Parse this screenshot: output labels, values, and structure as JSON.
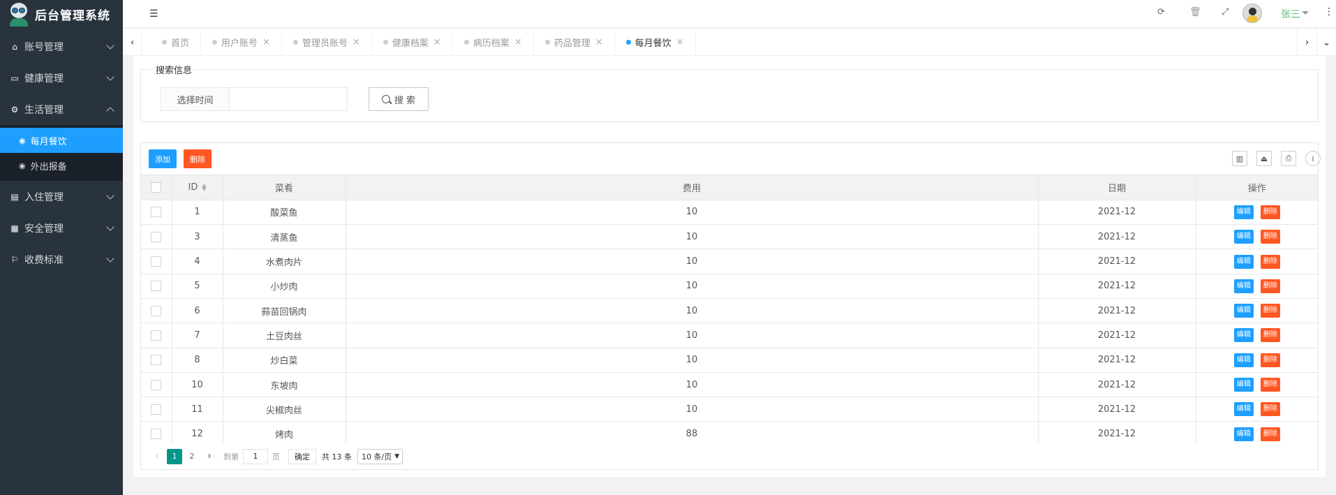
{
  "app": {
    "title": "后台管理系统"
  },
  "sidebar": {
    "items": [
      {
        "label": "账号管理",
        "icon": "home-icon",
        "expanded": false
      },
      {
        "label": "健康管理",
        "icon": "window-icon",
        "expanded": false
      },
      {
        "label": "生活管理",
        "icon": "gears-icon",
        "expanded": true
      },
      {
        "label": "入住管理",
        "icon": "file-icon",
        "expanded": false
      },
      {
        "label": "安全管理",
        "icon": "calendar-icon",
        "expanded": false
      },
      {
        "label": "收费标准",
        "icon": "flag-icon",
        "expanded": false
      }
    ],
    "subitems": [
      {
        "label": "每月餐饮",
        "icon": "dashboard-icon",
        "active": true
      },
      {
        "label": "外出报备",
        "icon": "dashboard-icon",
        "active": false
      }
    ]
  },
  "header": {
    "username": "张三",
    "icons": [
      "refresh-icon",
      "trash-icon",
      "fullscreen-icon",
      "more-icon"
    ]
  },
  "tabs": [
    {
      "label": "首页",
      "closable": false,
      "active": false
    },
    {
      "label": "用户账号",
      "closable": true,
      "active": false
    },
    {
      "label": "管理员账号",
      "closable": true,
      "active": false
    },
    {
      "label": "健康档案",
      "closable": true,
      "active": false
    },
    {
      "label": "病历档案",
      "closable": true,
      "active": false
    },
    {
      "label": "药品管理",
      "closable": true,
      "active": false
    },
    {
      "label": "每月餐饮",
      "closable": true,
      "active": true
    }
  ],
  "search": {
    "legend": "搜索信息",
    "label": "选择时间",
    "value": "",
    "button": "搜 索"
  },
  "toolbar": {
    "add_label": "添加",
    "delete_label": "删除"
  },
  "table": {
    "columns": [
      "ID",
      "菜肴",
      "费用",
      "日期",
      "操作"
    ],
    "edit_label": "编辑",
    "delete_label": "删除",
    "rows": [
      {
        "id": "1",
        "dish": "酸菜鱼",
        "cost": "10",
        "date": "2021-12"
      },
      {
        "id": "3",
        "dish": "清蒸鱼",
        "cost": "10",
        "date": "2021-12"
      },
      {
        "id": "4",
        "dish": "水煮肉片",
        "cost": "10",
        "date": "2021-12"
      },
      {
        "id": "5",
        "dish": "小炒肉",
        "cost": "10",
        "date": "2021-12"
      },
      {
        "id": "6",
        "dish": "蒜苗回锅肉",
        "cost": "10",
        "date": "2021-12"
      },
      {
        "id": "7",
        "dish": "土豆肉丝",
        "cost": "10",
        "date": "2021-12"
      },
      {
        "id": "8",
        "dish": "炒白菜",
        "cost": "10",
        "date": "2021-12"
      },
      {
        "id": "10",
        "dish": "东坡肉",
        "cost": "10",
        "date": "2021-12"
      },
      {
        "id": "11",
        "dish": "尖椒肉丝",
        "cost": "10",
        "date": "2021-12"
      },
      {
        "id": "12",
        "dish": "烤肉",
        "cost": "88",
        "date": "2021-12"
      }
    ]
  },
  "pagination": {
    "pages": [
      "1",
      "2"
    ],
    "current": "1",
    "goto_label": "到第",
    "page_input": "1",
    "page_unit": "页",
    "confirm": "确定",
    "total": "共 13 条",
    "page_size": "10 条/页"
  },
  "colors": {
    "accent": "#1e9fff",
    "danger": "#ff5722",
    "sidebar": "#28333e",
    "page_active": "#009688",
    "username": "#5fb878"
  }
}
